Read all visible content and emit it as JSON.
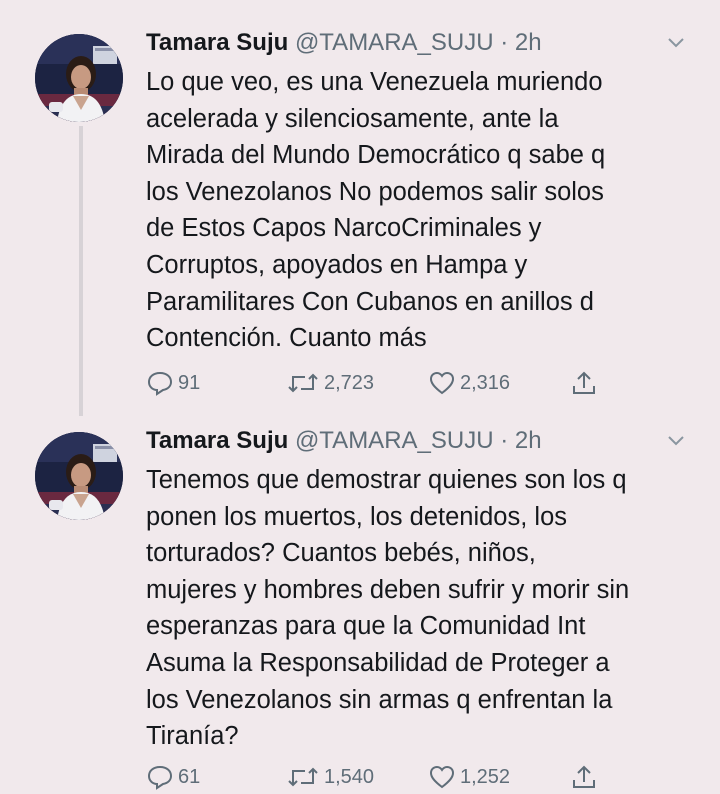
{
  "tweets": [
    {
      "author_name": "Tamara Suju",
      "handle": "@TAMARA_SUJU",
      "separator": "·",
      "time": "2h",
      "text": "Lo que veo, es una Venezuela muriendo\nacelerada y silenciosamente, ante la\nMirada del Mundo Democrático q sabe q\nlos Venezolanos No podemos salir solos\nde Estos Capos NarcoCriminales y\nCorruptos, apoyados en Hampa y\nParamilitares Con Cubanos en anillos d\nContención. Cuanto más",
      "replies": "91",
      "retweets": "2,723",
      "likes": "2,316",
      "icons": {
        "avatar": "avatar-photo",
        "caret": "chevron-down-icon",
        "reply": "reply-icon",
        "retweet": "retweet-icon",
        "like": "heart-icon",
        "share": "share-icon"
      }
    },
    {
      "author_name": "Tamara Suju",
      "handle": "@TAMARA_SUJU",
      "separator": "·",
      "time": "2h",
      "text": "Tenemos que demostrar quienes son los q\nponen los muertos, los detenidos, los\ntorturados? Cuantos bebés, niños,\nmujeres y hombres deben sufrir y morir sin\nesperanzas para que la Comunidad Int\nAsuma la Responsabilidad de Proteger a\nlos Venezolanos sin armas q enfrentan la\nTiranía?",
      "replies": "61",
      "retweets": "1,540",
      "likes": "1,252",
      "icons": {
        "avatar": "avatar-photo",
        "caret": "chevron-down-icon",
        "reply": "reply-icon",
        "retweet": "retweet-icon",
        "like": "heart-icon",
        "share": "share-icon"
      }
    }
  ],
  "colors": {
    "background": "#f1e9ec",
    "text": "#15181c",
    "secondary_text": "#5f6d78",
    "thread_line": "#d7d2d6"
  }
}
